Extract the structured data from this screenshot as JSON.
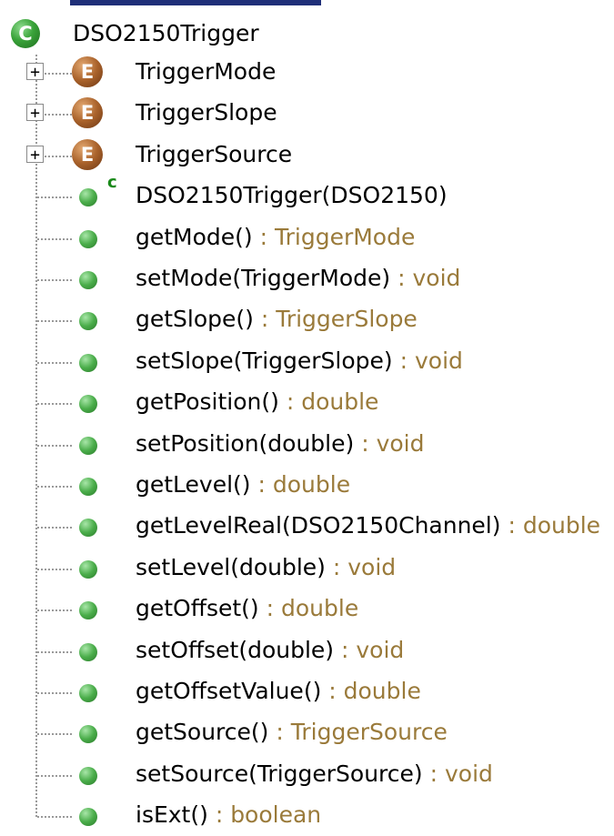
{
  "root": {
    "icon": "class-icon",
    "icon_glyph": "C",
    "label": "DSO2150Trigger"
  },
  "colors": {
    "return_type": "#9a7a3a",
    "class_icon": "#3aa33a",
    "enum_icon": "#a9622b",
    "method_icon": "#4aad4a",
    "title_bar": "#1f2f78"
  },
  "items": [
    {
      "kind": "enum",
      "icon": "enum-icon",
      "glyph": "E",
      "expander": "+",
      "name": "TriggerMode",
      "ret": ""
    },
    {
      "kind": "enum",
      "icon": "enum-icon",
      "glyph": "E",
      "expander": "+",
      "name": "TriggerSlope",
      "ret": ""
    },
    {
      "kind": "enum",
      "icon": "enum-icon",
      "glyph": "E",
      "expander": "+",
      "name": "TriggerSource",
      "ret": ""
    },
    {
      "kind": "constructor",
      "icon": "public-method-icon",
      "mark": "c",
      "name": "DSO2150Trigger(DSO2150)",
      "ret": ""
    },
    {
      "kind": "method",
      "icon": "public-method-icon",
      "name": "getMode()",
      "ret": " : TriggerMode"
    },
    {
      "kind": "method",
      "icon": "public-method-icon",
      "name": "setMode(TriggerMode)",
      "ret": " : void"
    },
    {
      "kind": "method",
      "icon": "public-method-icon",
      "name": "getSlope()",
      "ret": " : TriggerSlope"
    },
    {
      "kind": "method",
      "icon": "public-method-icon",
      "name": "setSlope(TriggerSlope)",
      "ret": " : void"
    },
    {
      "kind": "method",
      "icon": "public-method-icon",
      "name": "getPosition()",
      "ret": " : double"
    },
    {
      "kind": "method",
      "icon": "public-method-icon",
      "name": "setPosition(double)",
      "ret": " : void"
    },
    {
      "kind": "method",
      "icon": "public-method-icon",
      "name": "getLevel()",
      "ret": " : double"
    },
    {
      "kind": "method",
      "icon": "public-method-icon",
      "name": "getLevelReal(DSO2150Channel)",
      "ret": " : double"
    },
    {
      "kind": "method",
      "icon": "public-method-icon",
      "name": "setLevel(double)",
      "ret": " : void"
    },
    {
      "kind": "method",
      "icon": "public-method-icon",
      "name": "getOffset()",
      "ret": " : double"
    },
    {
      "kind": "method",
      "icon": "public-method-icon",
      "name": "setOffset(double)",
      "ret": " : void"
    },
    {
      "kind": "method",
      "icon": "public-method-icon",
      "name": "getOffsetValue()",
      "ret": " : double"
    },
    {
      "kind": "method",
      "icon": "public-method-icon",
      "name": "getSource()",
      "ret": " : TriggerSource"
    },
    {
      "kind": "method",
      "icon": "public-method-icon",
      "name": "setSource(TriggerSource)",
      "ret": " : void"
    },
    {
      "kind": "method",
      "icon": "public-method-icon",
      "name": "isExt()",
      "ret": " : boolean"
    }
  ]
}
